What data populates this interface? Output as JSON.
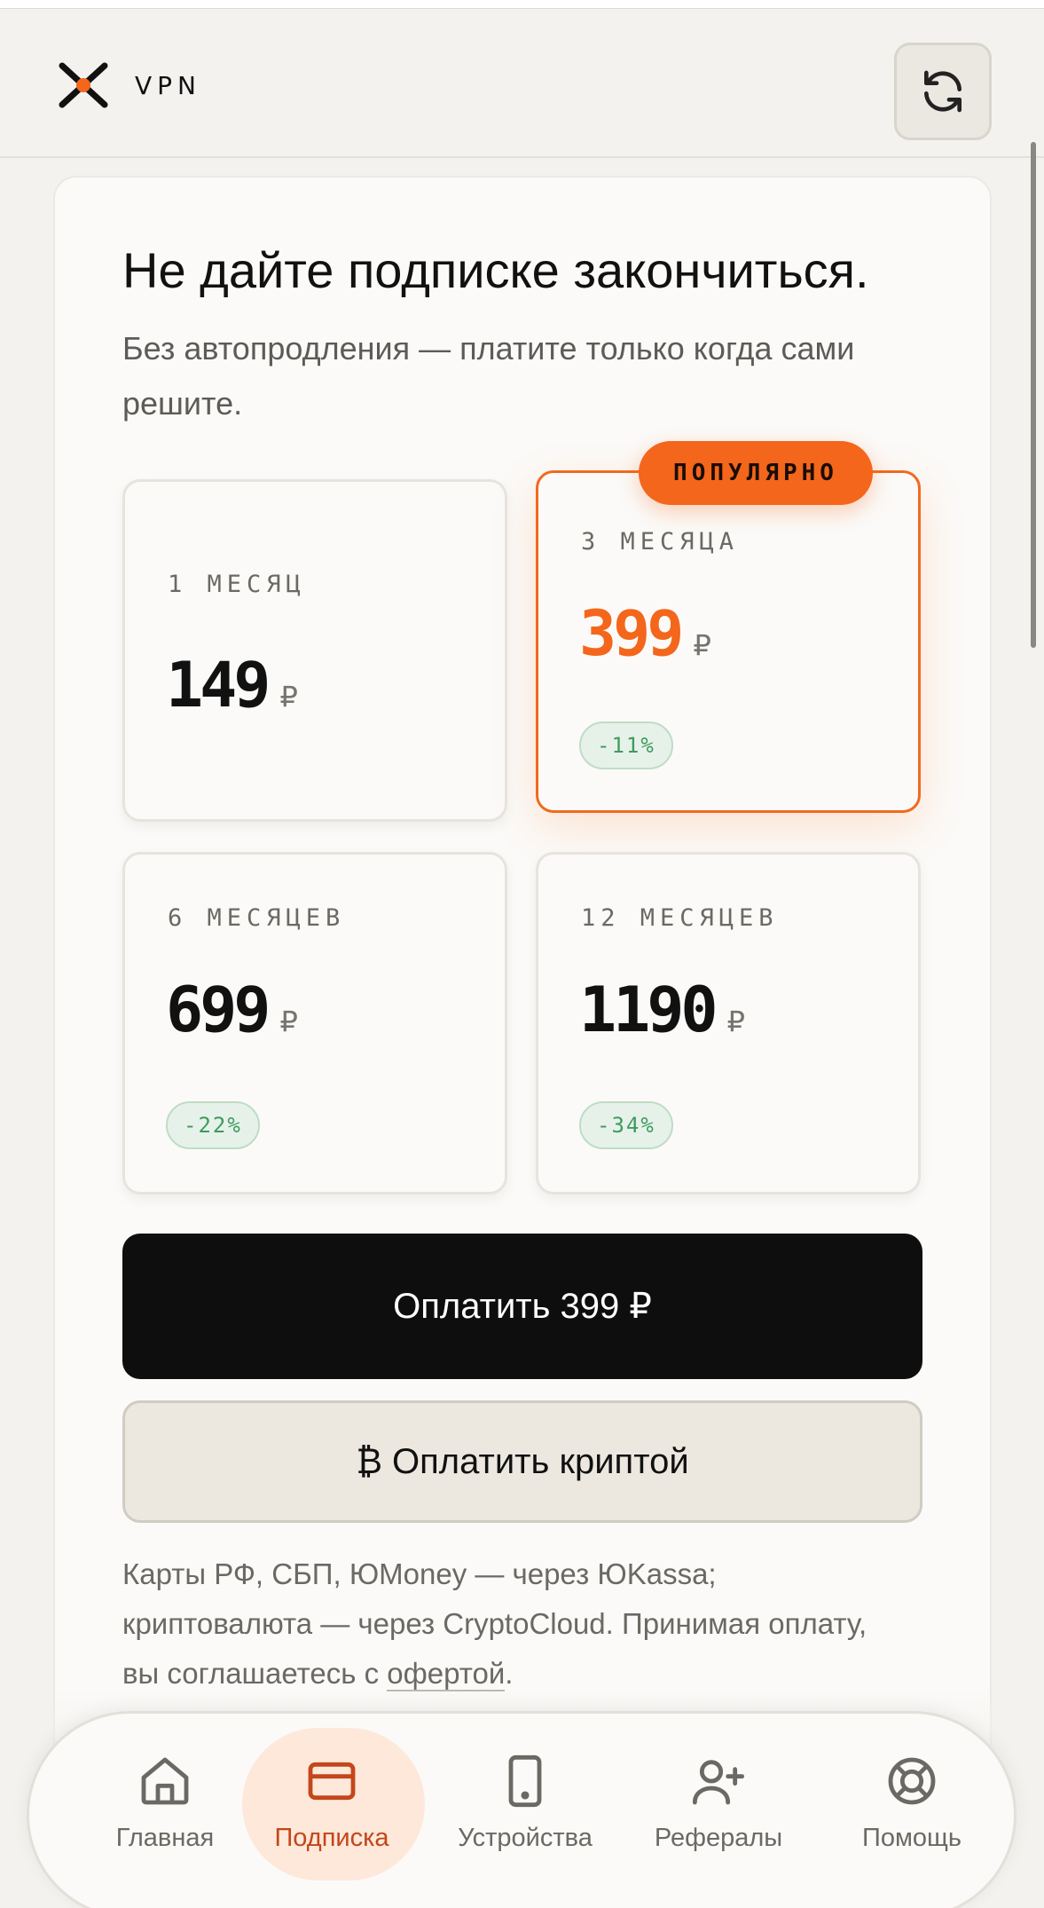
{
  "header": {
    "brand": "VPN",
    "refresh_icon": "refresh-icon",
    "logo_icon": "x-logo-icon"
  },
  "hero": {
    "title": "Не дайте подписке закончиться.",
    "subtitle": "Без автопродления — платите только когда сами решите."
  },
  "plans": [
    {
      "title": "1 МЕСЯЦ",
      "price": "149",
      "currency": "₽",
      "discount": "",
      "selected": false
    },
    {
      "title": "3 МЕСЯЦА",
      "price": "399",
      "currency": "₽",
      "discount": "-11%",
      "selected": true,
      "badge": "ПОПУЛЯРНО"
    },
    {
      "title": "6 МЕСЯЦЕВ",
      "price": "699",
      "currency": "₽",
      "discount": "-22%",
      "selected": false
    },
    {
      "title": "12 МЕСЯЦЕВ",
      "price": "1190",
      "currency": "₽",
      "discount": "-34%",
      "selected": false
    }
  ],
  "actions": {
    "pay_label": "Оплатить 399 ₽",
    "crypto_label": "₿ Оплатить криптой"
  },
  "note": {
    "text": "Карты РФ, СБП, ЮMoney — через ЮKassa; криптовалюта — через CryptoCloud. Принимая оплату, вы соглашаетесь с ",
    "link": "офертой",
    "end": "."
  },
  "tabs": [
    {
      "label": "Главная",
      "icon": "home-icon",
      "active": false
    },
    {
      "label": "Подписка",
      "icon": "card-icon",
      "active": true
    },
    {
      "label": "Устройства",
      "icon": "phone-icon",
      "active": false
    },
    {
      "label": "Рефералы",
      "icon": "add-user-icon",
      "active": false
    },
    {
      "label": "Помощь",
      "icon": "lifebuoy-icon",
      "active": false
    }
  ],
  "colors": {
    "accent": "#f4661b",
    "active_tab": "#c4461a",
    "discount_green": "#3f9a5f",
    "background": "#f3f2ef"
  }
}
